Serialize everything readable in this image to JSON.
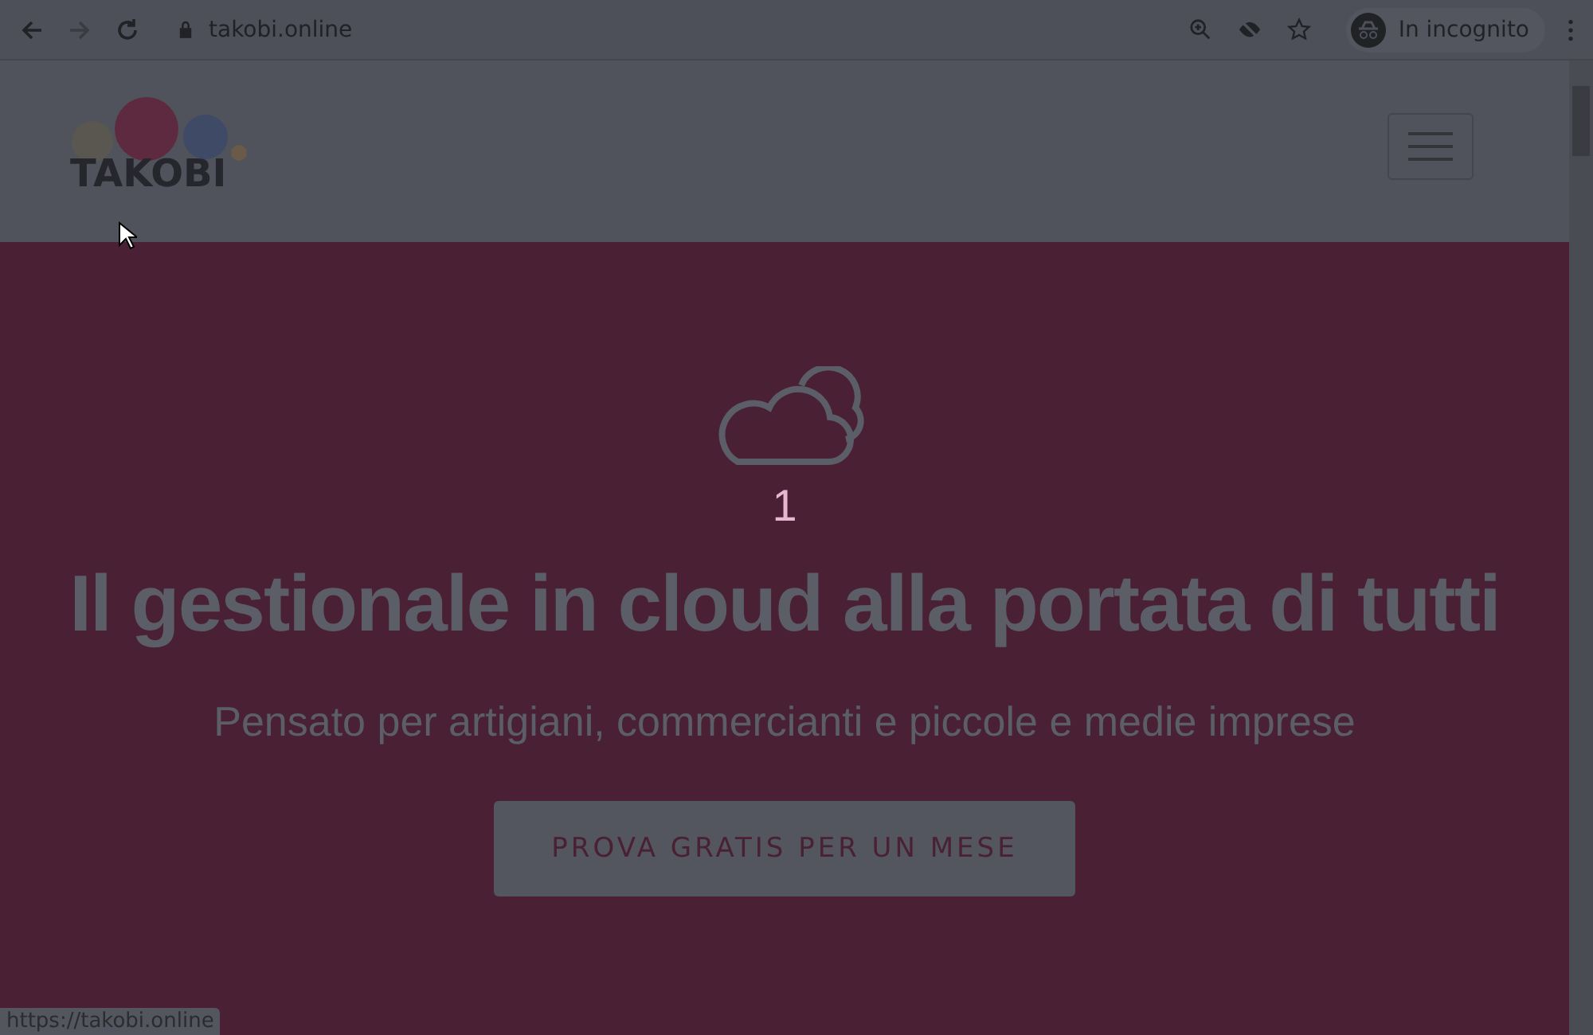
{
  "browser": {
    "url": "takobi.online",
    "incognito_label": "In incognito"
  },
  "header": {
    "logo_text": "TAKOBI"
  },
  "hero": {
    "step_number": "1",
    "title": "Il gestionale in cloud alla portata di tutti",
    "subtitle": "Pensato per artigiani, commercianti e piccole e medie imprese",
    "cta": "PROVA GRATIS PER UN MESE"
  },
  "status_url": "https://takobi.online"
}
